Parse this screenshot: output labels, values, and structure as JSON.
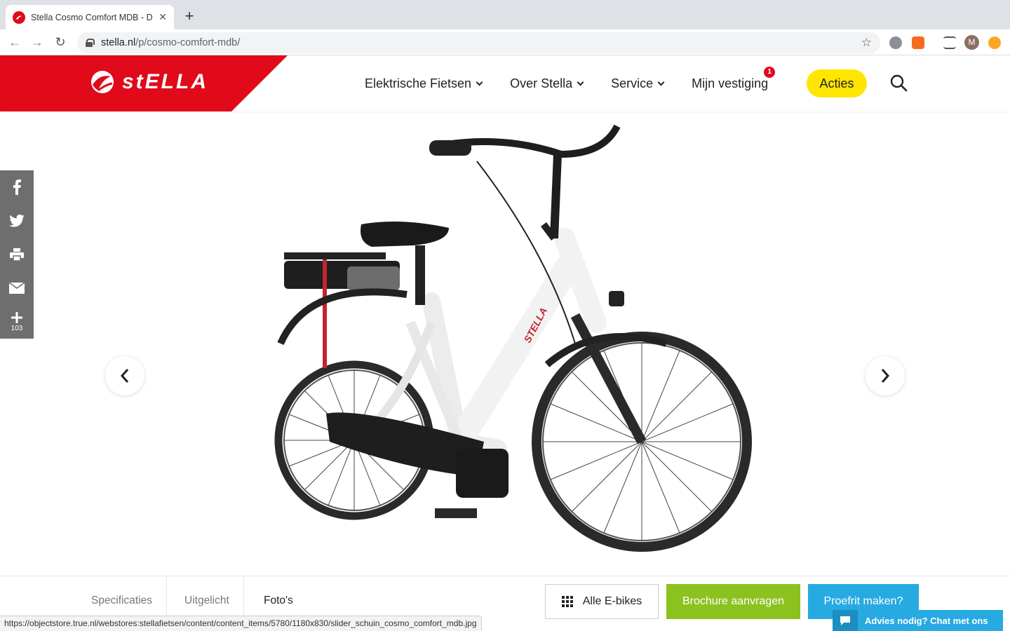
{
  "browser": {
    "tab_title": "Stella Cosmo Comfort MDB - D",
    "url_host": "stella.nl",
    "url_path": "/p/cosmo-comfort-mdb/",
    "avatar_letter": "M",
    "status_url": "https://objectstore.true.nl/webstores:stellafietsen/content/content_items/5780/1180x830/slider_schuin_cosmo_comfort_mdb.jpg"
  },
  "header": {
    "logo_text": "stELLA",
    "nav": [
      {
        "label": "Elektrische Fietsen"
      },
      {
        "label": "Over Stella"
      },
      {
        "label": "Service"
      },
      {
        "label": "Mijn vestiging",
        "badge": "1"
      }
    ],
    "cta_label": "Acties",
    "brand_color": "#e10a1a",
    "cta_color": "#ffe600"
  },
  "share": {
    "items": [
      "facebook-icon",
      "twitter-icon",
      "print-icon",
      "mail-icon",
      "plus-icon"
    ],
    "count": "103"
  },
  "bottom": {
    "tabs": [
      "Specificaties",
      "Uitgelicht",
      "Foto's"
    ],
    "all_bikes_label": "Alle E-bikes",
    "brochure_label": "Brochure aanvragen",
    "testride_label": "Proefrit maken?",
    "chat_label": "Advies nodig? Chat met ons",
    "colors": {
      "brochure": "#8cc21f",
      "testride": "#27aae1"
    }
  }
}
